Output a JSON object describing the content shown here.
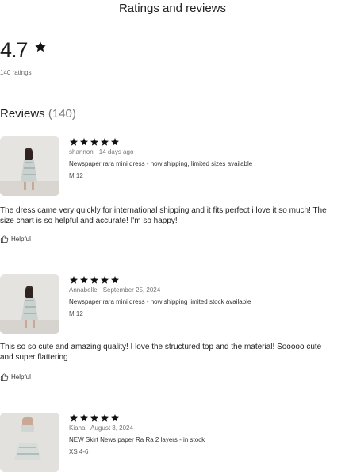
{
  "header": {
    "title": "Ratings and reviews"
  },
  "summary": {
    "rating": "4.7",
    "ratings_count": "140 ratings",
    "star_icon": "star-icon"
  },
  "reviews_section": {
    "heading": "Reviews",
    "count": "(140)"
  },
  "reviews": [
    {
      "stars": 5,
      "meta": "shannon · 14 days ago",
      "item": "Newspaper rara mini dress - now shipping, limited sizes available",
      "variant": "M 12",
      "text": "The dress came very quickly for international shipping and it fits perfect i love it so much! The size chart is so helpful and accurate! I'm so happy!",
      "helpful_label": "Helpful"
    },
    {
      "stars": 5,
      "meta": "Annabelle · September 25, 2024",
      "item": "Newspaper rara mini dress - now shipping limited stock available",
      "variant": "M 12",
      "text": "This so so cute and amazing quality! I love the structured top and the material! Sooooo cute and super flattering",
      "helpful_label": "Helpful"
    },
    {
      "stars": 5,
      "meta": "Kiana · August 3, 2024",
      "item": "NEW Skirt News paper Ra Ra 2 layers - in stock",
      "variant": "XS 4-6"
    }
  ],
  "colors": {
    "star": "#111111",
    "divider": "#ececec",
    "muted": "#757575"
  }
}
